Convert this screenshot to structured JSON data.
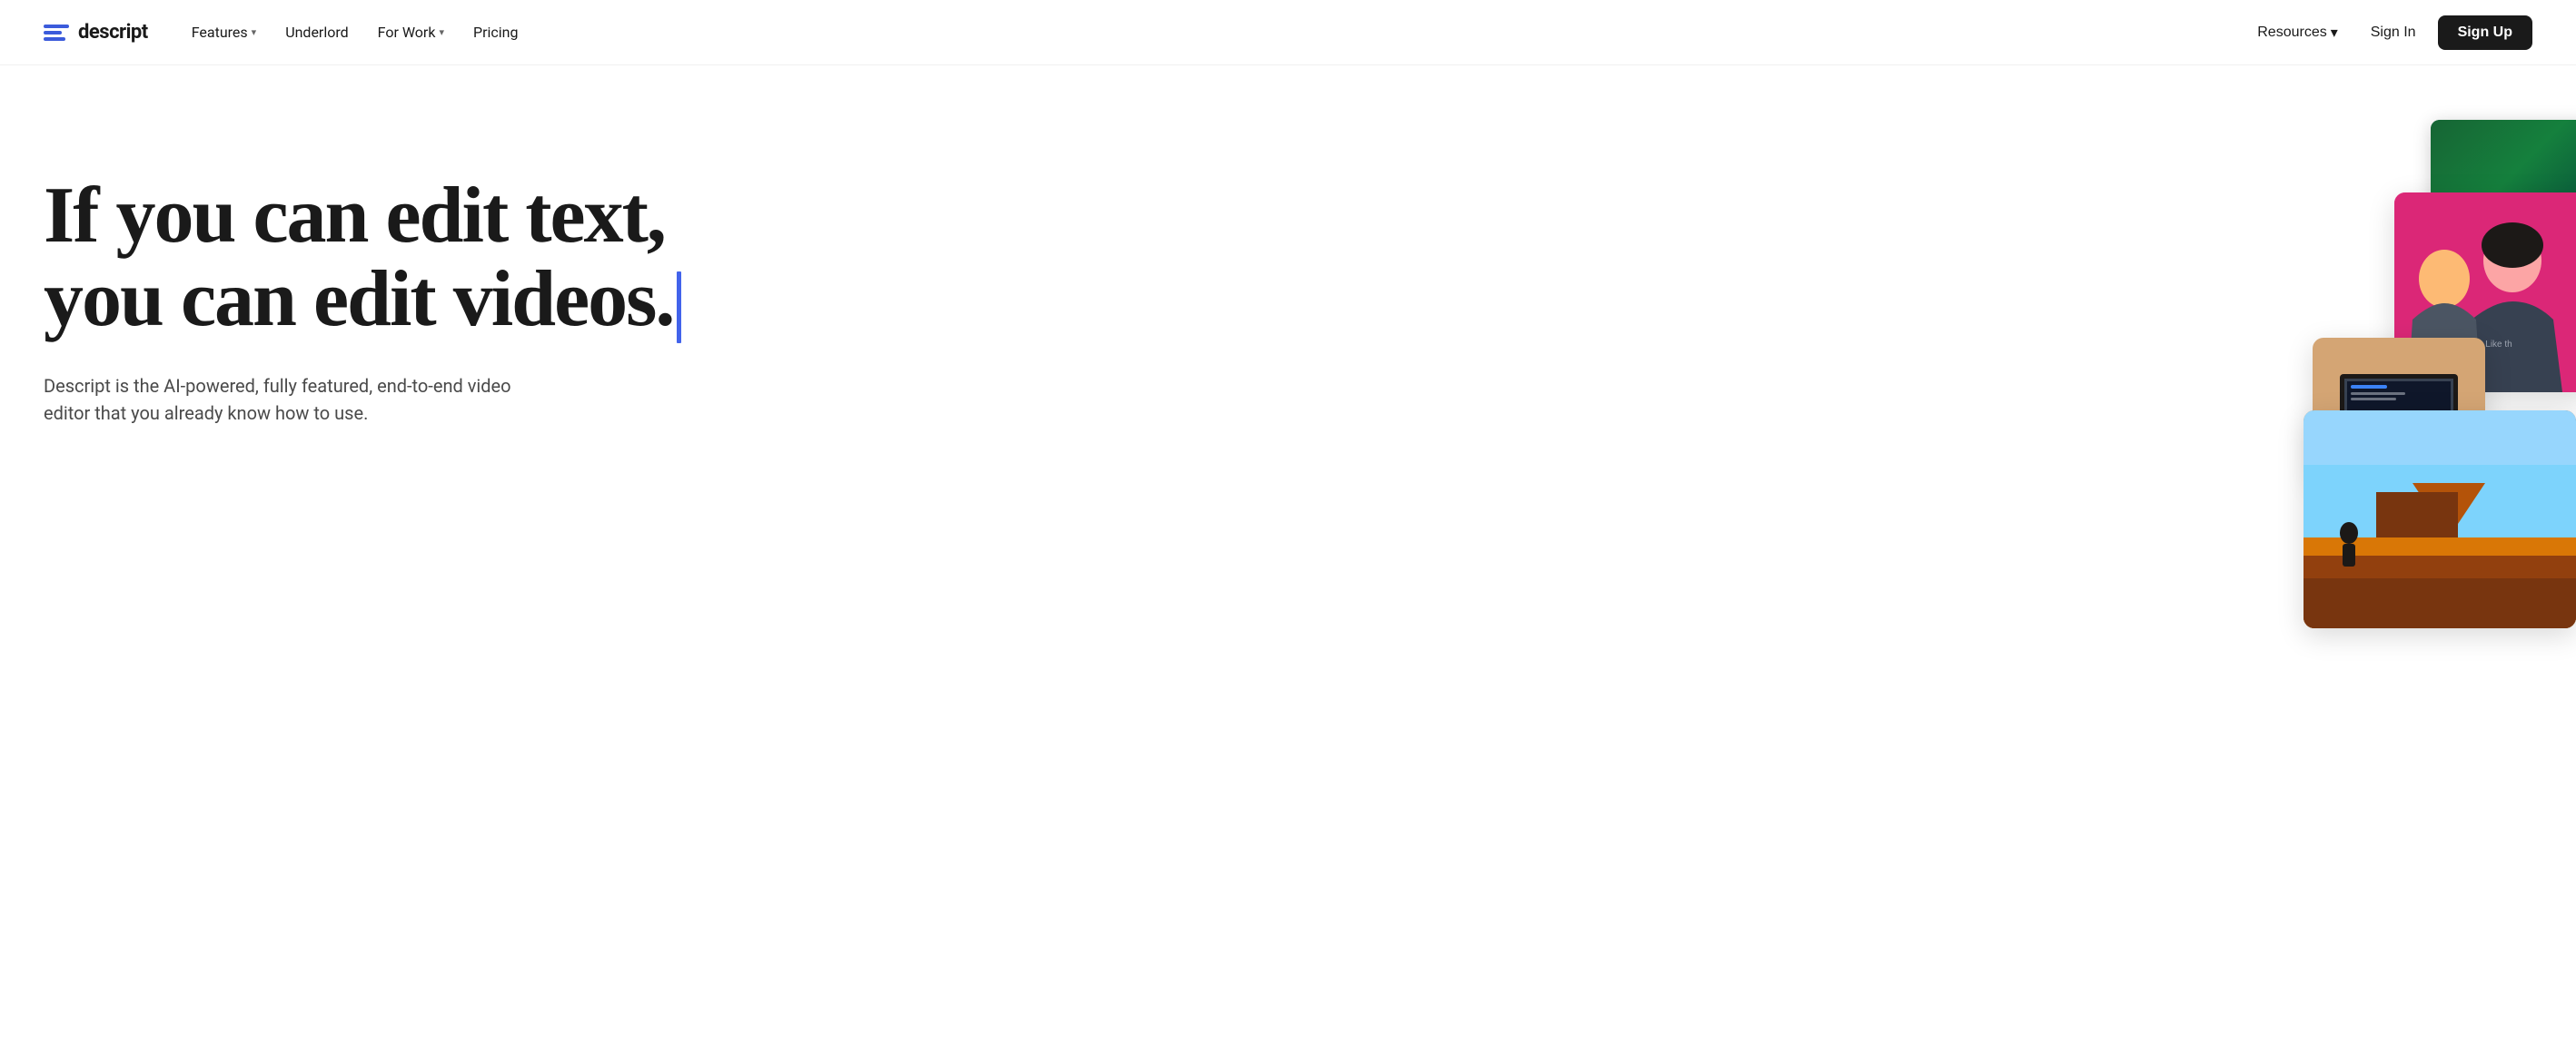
{
  "nav": {
    "logo": {
      "text": "descript",
      "aria": "Descript logo"
    },
    "links": [
      {
        "label": "Features",
        "hasDropdown": true
      },
      {
        "label": "Underlord",
        "hasDropdown": false
      },
      {
        "label": "For Work",
        "hasDropdown": true
      },
      {
        "label": "Pricing",
        "hasDropdown": false
      }
    ],
    "right": {
      "resources_label": "Resources",
      "signin_label": "Sign In",
      "signup_label": "Sign Up"
    }
  },
  "hero": {
    "title_line1": "If you can edit text,",
    "title_line2": "you can edit videos.",
    "subtitle": "Descript is the AI-powered, fully featured, end-to-end video editor that you already know how to use."
  },
  "colors": {
    "accent_blue": "#4263eb",
    "nav_bg": "#ffffff",
    "text_dark": "#1a1a1a",
    "text_muted": "#4a4a4a",
    "logo_blue": "#3b5bdb"
  }
}
